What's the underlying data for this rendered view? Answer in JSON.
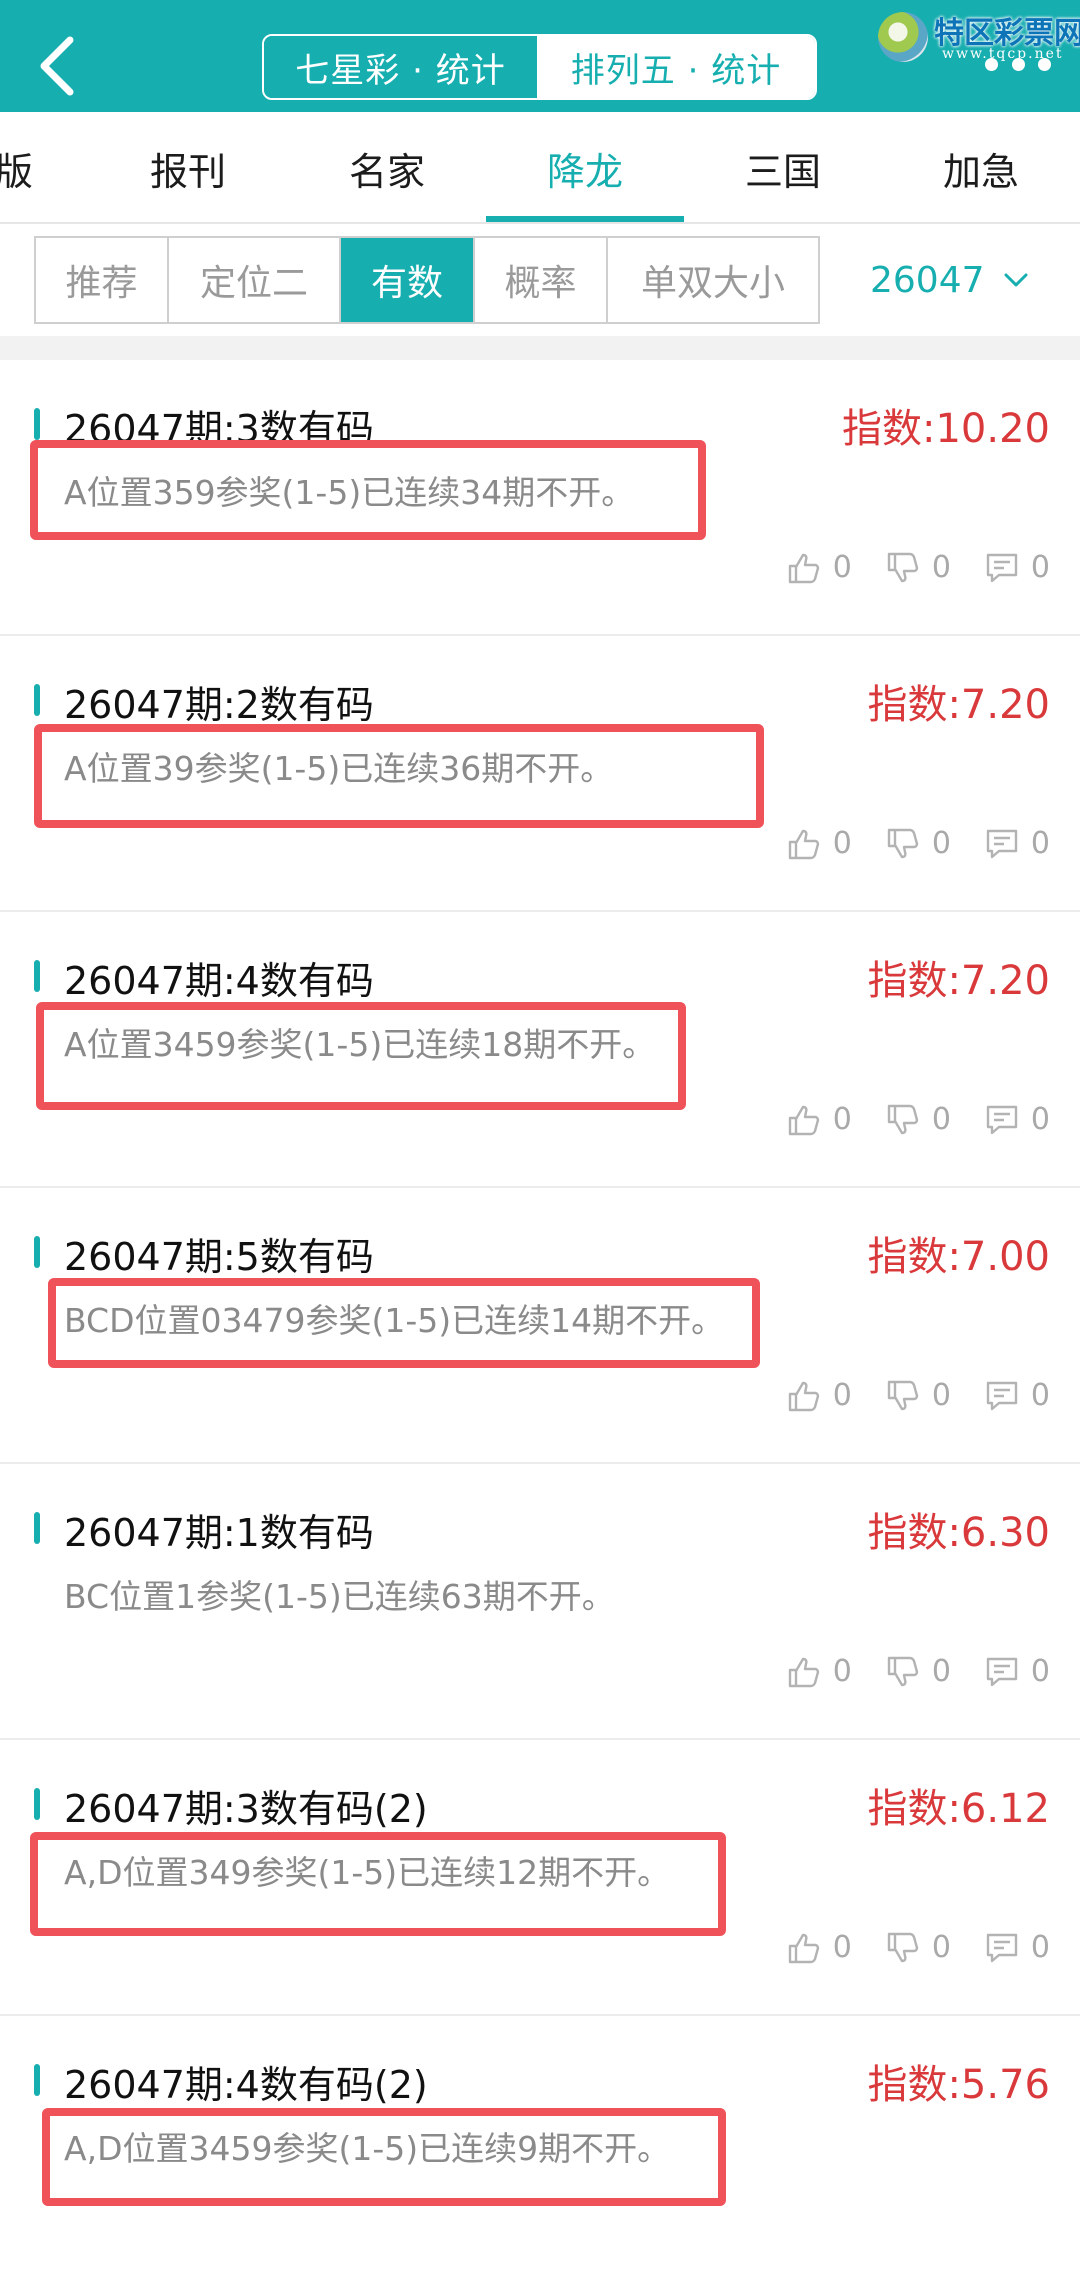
{
  "header": {
    "seg_tabs": [
      {
        "label": "七星彩 · 统计"
      },
      {
        "label": "排列五 · 统计"
      }
    ],
    "watermark_title": "特区彩票网",
    "watermark_url": "www.tqcp.net"
  },
  "category_tabs": [
    {
      "label": "版"
    },
    {
      "label": "报刊"
    },
    {
      "label": "名家"
    },
    {
      "label": "降龙"
    },
    {
      "label": "三国"
    },
    {
      "label": "加急"
    }
  ],
  "filters": [
    {
      "label": "推荐"
    },
    {
      "label": "定位二"
    },
    {
      "label": "有数"
    },
    {
      "label": "概率"
    },
    {
      "label": "单双大小"
    }
  ],
  "period": {
    "value": "26047"
  },
  "items": [
    {
      "title": "26047期:3数有码",
      "index": "指数:10.20",
      "desc": "A位置359参奖(1-5)已连续34期不开。",
      "likes": "0",
      "dislikes": "0",
      "comments": "0"
    },
    {
      "title": "26047期:2数有码",
      "index": "指数:7.20",
      "desc": "A位置39参奖(1-5)已连续36期不开。",
      "likes": "0",
      "dislikes": "0",
      "comments": "0"
    },
    {
      "title": "26047期:4数有码",
      "index": "指数:7.20",
      "desc": "A位置3459参奖(1-5)已连续18期不开。",
      "likes": "0",
      "dislikes": "0",
      "comments": "0"
    },
    {
      "title": "26047期:5数有码",
      "index": "指数:7.00",
      "desc": "BCD位置03479参奖(1-5)已连续14期不开。",
      "likes": "0",
      "dislikes": "0",
      "comments": "0"
    },
    {
      "title": "26047期:1数有码",
      "index": "指数:6.30",
      "desc": "BC位置1参奖(1-5)已连续63期不开。",
      "likes": "0",
      "dislikes": "0",
      "comments": "0"
    },
    {
      "title": "26047期:3数有码(2)",
      "index": "指数:6.12",
      "desc": "A,D位置349参奖(1-5)已连续12期不开。",
      "likes": "0",
      "dislikes": "0",
      "comments": "0"
    },
    {
      "title": "26047期:4数有码(2)",
      "index": "指数:5.76",
      "desc": "A,D位置3459参奖(1-5)已连续9期不开。",
      "likes": "0",
      "dislikes": "0",
      "comments": "0"
    }
  ],
  "colors": {
    "accent": "#17aeb0",
    "index_red": "#d9393b",
    "highlight": "#f0525a"
  },
  "icons": [
    "back-chevron-icon",
    "more-dots-icon",
    "chevron-down-icon",
    "thumbs-up-icon",
    "thumbs-down-icon",
    "comment-icon"
  ]
}
